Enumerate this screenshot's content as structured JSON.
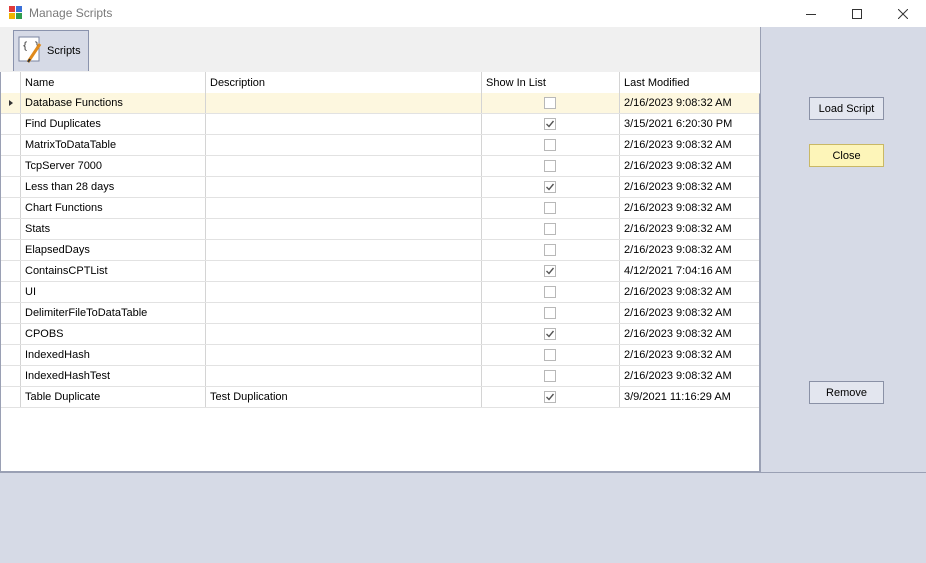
{
  "window": {
    "title": "Manage Scripts"
  },
  "ribbon": {
    "tab_label": "Scripts"
  },
  "grid": {
    "columns": [
      "Name",
      "Description",
      "Show In List",
      "Last Modified"
    ],
    "rows": [
      {
        "name": "Database Functions",
        "description": "",
        "show_in_list": false,
        "last_modified": "2/16/2023 9:08:32 AM",
        "selected": true
      },
      {
        "name": "Find Duplicates",
        "description": "",
        "show_in_list": true,
        "last_modified": "3/15/2021 6:20:30 PM"
      },
      {
        "name": "MatrixToDataTable",
        "description": "",
        "show_in_list": false,
        "last_modified": "2/16/2023 9:08:32 AM"
      },
      {
        "name": "TcpServer 7000",
        "description": "",
        "show_in_list": false,
        "last_modified": "2/16/2023 9:08:32 AM"
      },
      {
        "name": "Less than 28 days",
        "description": "",
        "show_in_list": true,
        "last_modified": "2/16/2023 9:08:32 AM"
      },
      {
        "name": "Chart Functions",
        "description": "",
        "show_in_list": false,
        "last_modified": "2/16/2023 9:08:32 AM"
      },
      {
        "name": "Stats",
        "description": "",
        "show_in_list": false,
        "last_modified": "2/16/2023 9:08:32 AM"
      },
      {
        "name": "ElapsedDays",
        "description": "",
        "show_in_list": false,
        "last_modified": "2/16/2023 9:08:32 AM"
      },
      {
        "name": "ContainsCPTList",
        "description": "",
        "show_in_list": true,
        "last_modified": "4/12/2021 7:04:16 AM"
      },
      {
        "name": "UI",
        "description": "",
        "show_in_list": false,
        "last_modified": "2/16/2023 9:08:32 AM"
      },
      {
        "name": "DelimiterFileToDataTable",
        "description": "",
        "show_in_list": false,
        "last_modified": "2/16/2023 9:08:32 AM"
      },
      {
        "name": "CPOBS",
        "description": "",
        "show_in_list": true,
        "last_modified": "2/16/2023 9:08:32 AM"
      },
      {
        "name": "IndexedHash",
        "description": "",
        "show_in_list": false,
        "last_modified": "2/16/2023 9:08:32 AM"
      },
      {
        "name": "IndexedHashTest",
        "description": "",
        "show_in_list": false,
        "last_modified": "2/16/2023 9:08:32 AM"
      },
      {
        "name": "Table Duplicate",
        "description": "Test Duplication",
        "show_in_list": true,
        "last_modified": "3/9/2021 11:16:29 AM"
      }
    ]
  },
  "actions": {
    "load_label": "Load Script",
    "close_label": "Close",
    "remove_label": "Remove"
  },
  "colors": {
    "panel_bg": "#d6dae6",
    "selected_row": "#fdf7df",
    "close_button": "#fdf5b9"
  },
  "icons": {
    "app": "app-window-icon",
    "tab": "script-braces-pen-icon",
    "check": "checkmark-icon",
    "row_indicator": "row-indicator-arrow-icon"
  }
}
